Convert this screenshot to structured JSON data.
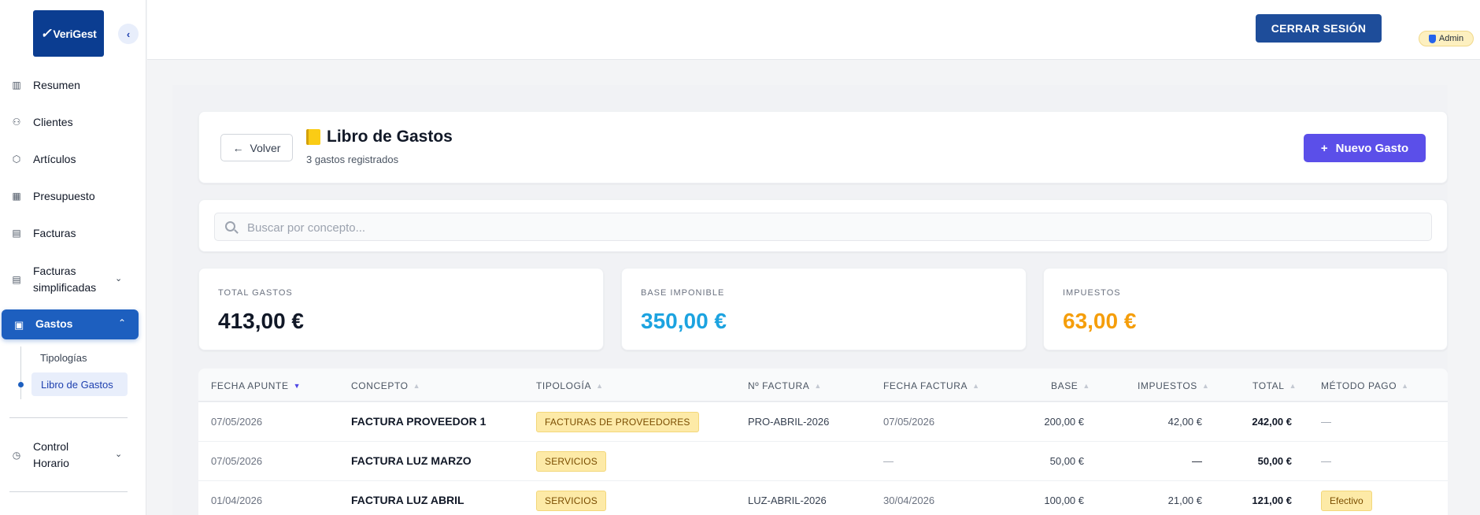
{
  "sidebar": {
    "logo_text": "VeriGest",
    "items": [
      {
        "label": "Resumen",
        "icon": "chart-icon"
      },
      {
        "label": "Clientes",
        "icon": "users-icon"
      },
      {
        "label": "Artículos",
        "icon": "box-icon"
      },
      {
        "label": "Presupuesto",
        "icon": "calculator-icon"
      },
      {
        "label": "Facturas",
        "icon": "invoice-icon"
      },
      {
        "label": "Facturas simplificadas",
        "label_line1": "Facturas",
        "label_line2": "simplificadas",
        "icon": "receipt-icon"
      },
      {
        "label": "Gastos",
        "icon": "wallet-icon",
        "active": true
      },
      {
        "label": "Control Horario",
        "label_line1": "Control",
        "label_line2": "Horario",
        "icon": "clock-icon"
      }
    ],
    "gastos_subitems": [
      {
        "label": "Tipologías"
      },
      {
        "label": "Libro de Gastos",
        "active": true
      }
    ]
  },
  "header": {
    "logout_label": "CERRAR SESIÓN",
    "role_badge": "Admin"
  },
  "page": {
    "back_label": "Volver",
    "title": "Libro de Gastos",
    "subtitle": "3 gastos registrados",
    "new_button_label": "Nuevo Gasto",
    "search_placeholder": "Buscar por concepto..."
  },
  "stats": [
    {
      "label": "TOTAL GASTOS",
      "value": "413,00 €",
      "color": "#111827"
    },
    {
      "label": "BASE IMPONIBLE",
      "value": "350,00 €",
      "color": "#1ca3e0"
    },
    {
      "label": "IMPUESTOS",
      "value": "63,00 €",
      "color": "#f59e0b"
    }
  ],
  "table": {
    "columns": [
      "FECHA APUNTE",
      "CONCEPTO",
      "TIPOLOGÍA",
      "Nº FACTURA",
      "FECHA FACTURA",
      "BASE",
      "IMPUESTOS",
      "TOTAL",
      "MÉTODO PAGO"
    ],
    "sorted_column": "FECHA APUNTE",
    "rows": [
      {
        "fecha_apunte": "07/05/2026",
        "concepto": "FACTURA PROVEEDOR 1",
        "tipologia": "FACTURAS DE PROVEEDORES",
        "n_factura": "PRO-ABRIL-2026",
        "fecha_factura": "07/05/2026",
        "base": "200,00 €",
        "impuestos": "42,00 €",
        "total": "242,00 €",
        "metodo_pago": "—"
      },
      {
        "fecha_apunte": "07/05/2026",
        "concepto": "FACTURA LUZ MARZO",
        "tipologia": "SERVICIOS",
        "n_factura": "",
        "fecha_factura": "—",
        "base": "50,00 €",
        "impuestos": "—",
        "total": "50,00 €",
        "metodo_pago": "—"
      },
      {
        "fecha_apunte": "01/04/2026",
        "concepto": "FACTURA LUZ ABRIL",
        "tipologia": "SERVICIOS",
        "n_factura": "LUZ-ABRIL-2026",
        "fecha_factura": "30/04/2026",
        "base": "100,00 €",
        "impuestos": "21,00 €",
        "total": "121,00 €",
        "metodo_pago": "Efectivo"
      }
    ]
  }
}
